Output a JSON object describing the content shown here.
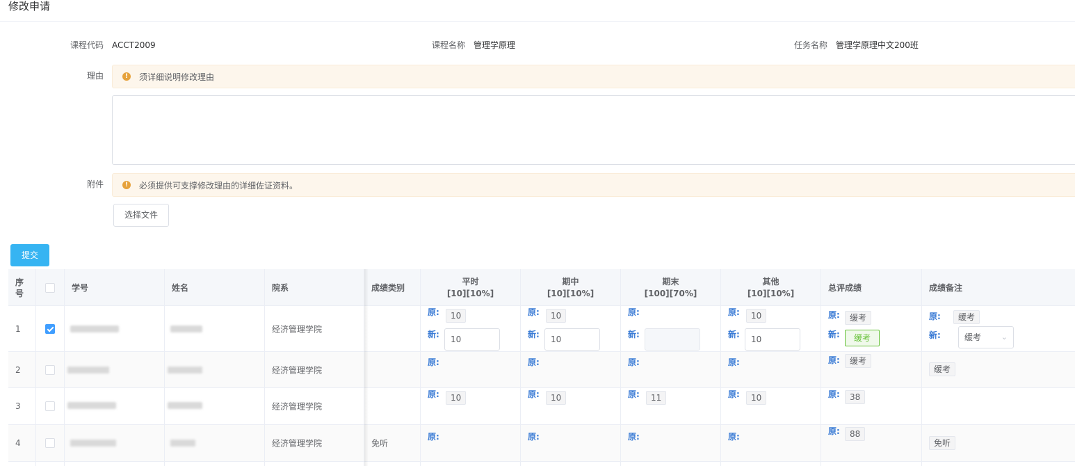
{
  "page": {
    "title": "修改申请"
  },
  "info": {
    "course_code_label": "课程代码",
    "course_code": "ACCT2009",
    "course_name_label": "课程名称",
    "course_name": "管理学原理",
    "task_name_label": "任务名称",
    "task_name": "管理学原理中文200班"
  },
  "reason": {
    "label": "理由",
    "notice": "须详细说明修改理由",
    "value": ""
  },
  "attachment": {
    "label": "附件",
    "notice": "必须提供可支撑修改理由的详细佐证资料。",
    "button": "选择文件"
  },
  "submit_label": "提交",
  "accent": "#36b4f2",
  "table": {
    "headers": {
      "seq": "序\n号",
      "student_id": "学号",
      "name": "姓名",
      "dept": "院系",
      "category": "成绩类别",
      "regular": "平时\n[10][10%]",
      "midterm": "期中\n[10][10%]",
      "final": "期末\n[100][70%]",
      "other": "其他\n[10][10%]",
      "total": "总评成绩",
      "remark": "成绩备注"
    },
    "orig_label": "原:",
    "new_label": "新:",
    "rows": [
      {
        "seq": "1",
        "checked": true,
        "dept": "经济管理学院",
        "category": "",
        "regular_orig": "10",
        "regular_new": "10",
        "mid_orig": "10",
        "mid_new": "10",
        "final_orig": "",
        "final_new": "",
        "other_orig": "10",
        "other_new": "10",
        "total_orig": "缓考",
        "total_new": "缓考",
        "remark_orig": "缓考",
        "remark_new": "缓考"
      },
      {
        "seq": "2",
        "checked": false,
        "dept": "经济管理学院",
        "category": "",
        "regular_orig": "",
        "mid_orig": "",
        "final_orig": "",
        "other_orig": "",
        "total_orig": "缓考",
        "remark": "缓考"
      },
      {
        "seq": "3",
        "checked": false,
        "dept": "经济管理学院",
        "category": "",
        "regular_orig": "10",
        "mid_orig": "10",
        "final_orig": "11",
        "other_orig": "10",
        "total_orig": "38",
        "remark": ""
      },
      {
        "seq": "4",
        "checked": false,
        "dept": "经济管理学院",
        "category": "免听",
        "regular_orig": "",
        "mid_orig": "",
        "final_orig": "",
        "other_orig": "",
        "total_orig": "88",
        "remark": "免听"
      }
    ]
  }
}
